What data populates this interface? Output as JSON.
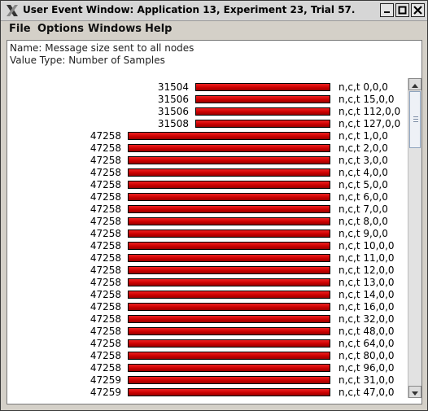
{
  "window": {
    "title": "User Event Window: Application 13, Experiment 23, Trial 57.",
    "icon": "x-window-icon",
    "buttons": [
      "minimize",
      "maximize",
      "close"
    ]
  },
  "menu": {
    "items": [
      "File",
      "Options",
      "Windows",
      "Help"
    ]
  },
  "info": {
    "name_line": "Name: Message size sent to all nodes",
    "type_line": "Value Type: Number of Samples"
  },
  "bar_color": "#cc0000",
  "bar_max": 47259,
  "rows": [
    {
      "value": "31504",
      "label": "n,c,t 0,0,0"
    },
    {
      "value": "31506",
      "label": "n,c,t 15,0,0"
    },
    {
      "value": "31506",
      "label": "n,c,t 112,0,0"
    },
    {
      "value": "31508",
      "label": "n,c,t 127,0,0"
    },
    {
      "value": "47258",
      "label": "n,c,t 1,0,0"
    },
    {
      "value": "47258",
      "label": "n,c,t 2,0,0"
    },
    {
      "value": "47258",
      "label": "n,c,t 3,0,0"
    },
    {
      "value": "47258",
      "label": "n,c,t 4,0,0"
    },
    {
      "value": "47258",
      "label": "n,c,t 5,0,0"
    },
    {
      "value": "47258",
      "label": "n,c,t 6,0,0"
    },
    {
      "value": "47258",
      "label": "n,c,t 7,0,0"
    },
    {
      "value": "47258",
      "label": "n,c,t 8,0,0"
    },
    {
      "value": "47258",
      "label": "n,c,t 9,0,0"
    },
    {
      "value": "47258",
      "label": "n,c,t 10,0,0"
    },
    {
      "value": "47258",
      "label": "n,c,t 11,0,0"
    },
    {
      "value": "47258",
      "label": "n,c,t 12,0,0"
    },
    {
      "value": "47258",
      "label": "n,c,t 13,0,0"
    },
    {
      "value": "47258",
      "label": "n,c,t 14,0,0"
    },
    {
      "value": "47258",
      "label": "n,c,t 16,0,0"
    },
    {
      "value": "47258",
      "label": "n,c,t 32,0,0"
    },
    {
      "value": "47258",
      "label": "n,c,t 48,0,0"
    },
    {
      "value": "47258",
      "label": "n,c,t 64,0,0"
    },
    {
      "value": "47258",
      "label": "n,c,t 80,0,0"
    },
    {
      "value": "47258",
      "label": "n,c,t 96,0,0"
    },
    {
      "value": "47259",
      "label": "n,c,t 31,0,0"
    },
    {
      "value": "47259",
      "label": "n,c,t 47,0,0"
    }
  ]
}
